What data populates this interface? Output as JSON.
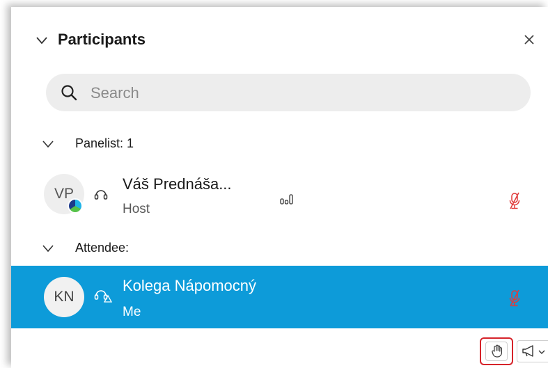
{
  "panel": {
    "title": "Participants"
  },
  "search": {
    "placeholder": "Search"
  },
  "sections": {
    "panelists_label": "Panelist: 1",
    "attendees_label": "Attendee:"
  },
  "panelists": [
    {
      "initials": "VP",
      "name": "Váš Prednáša...",
      "role": "Host"
    }
  ],
  "attendees": [
    {
      "initials": "KN",
      "name": "Kolega Nápomocný",
      "role": "Me",
      "selected": true
    }
  ],
  "icons": {
    "collapse": "chevron-down-icon",
    "close": "close-icon",
    "search": "search-icon",
    "headset": "headset-icon",
    "signal": "signal-bars-icon",
    "mic_muted": "microphone-muted-icon",
    "raise_hand": "raise-hand-icon",
    "announce": "megaphone-icon"
  },
  "colors": {
    "selected_row": "#0d9bd9",
    "muted_mic": "#e03a3a",
    "highlight_border": "#d6232a"
  }
}
